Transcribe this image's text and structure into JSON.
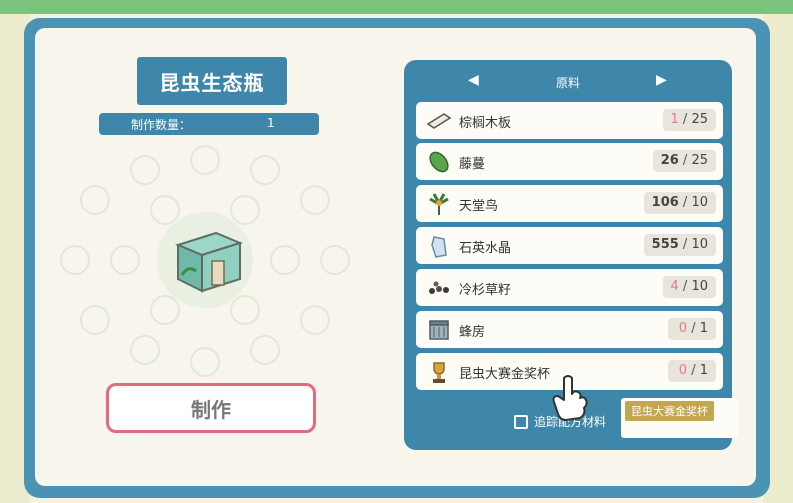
{
  "title": "昆虫生态瓶",
  "quantity": {
    "label": "制作数量：",
    "value": "1"
  },
  "craft_button": "制作",
  "materials_panel": {
    "title": "原料",
    "items": [
      {
        "name": "棕榈木板",
        "have": "1",
        "need": "25",
        "status": "short",
        "icon": "plank-icon"
      },
      {
        "name": "藤蔓",
        "have": "26",
        "need": "25",
        "status": "ok",
        "icon": "vine-icon"
      },
      {
        "name": "天堂鸟",
        "have": "106",
        "need": "10",
        "status": "ok",
        "icon": "bird-of-paradise-icon"
      },
      {
        "name": "石英水晶",
        "have": "555",
        "need": "10",
        "status": "ok",
        "icon": "quartz-crystal-icon"
      },
      {
        "name": "冷杉草籽",
        "have": "4",
        "need": "10",
        "status": "short",
        "icon": "seeds-icon"
      },
      {
        "name": "蜂房",
        "have": "0",
        "need": "1",
        "status": "short",
        "icon": "beehive-icon"
      },
      {
        "name": "昆虫大赛金奖杯",
        "have": "0",
        "need": "1",
        "status": "short",
        "icon": "trophy-icon"
      }
    ],
    "track_label": "追踪配方材料"
  },
  "tooltip": "昆虫大赛金奖杯",
  "colors": {
    "panel": "#3f87aa",
    "frame": "#4a93b5",
    "short": "#e57b86",
    "craft_border": "#e36b7d",
    "tooltip": "#c3a64d"
  }
}
